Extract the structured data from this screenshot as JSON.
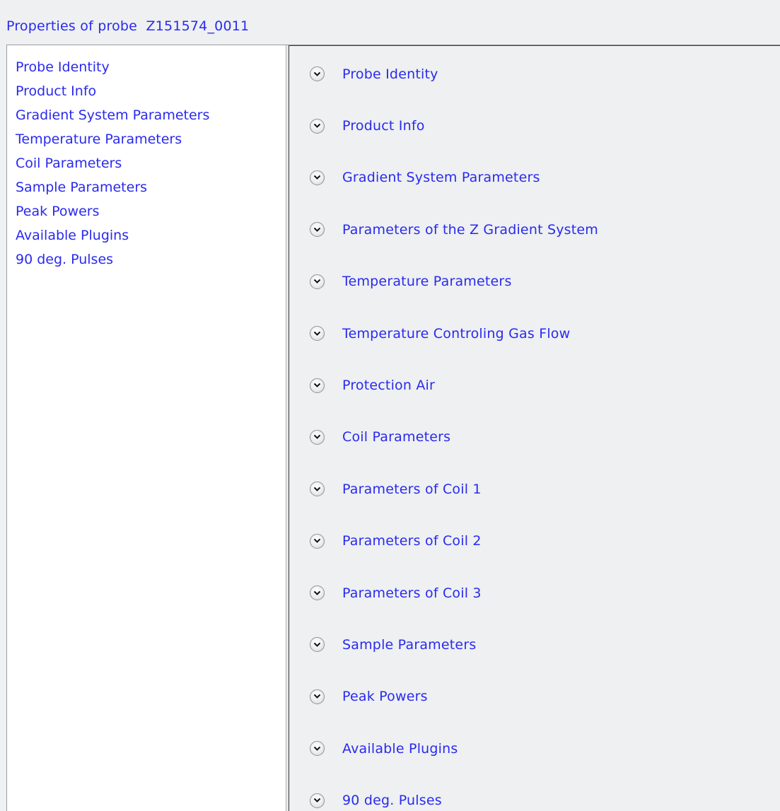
{
  "window": {
    "title": "Properties of probe  Z151574_0011"
  },
  "navigation": {
    "items": [
      {
        "label": "Probe Identity"
      },
      {
        "label": "Product Info"
      },
      {
        "label": "Gradient System Parameters"
      },
      {
        "label": "Temperature Parameters"
      },
      {
        "label": "Coil Parameters"
      },
      {
        "label": "Sample Parameters"
      },
      {
        "label": "Peak Powers"
      },
      {
        "label": "Available Plugins"
      },
      {
        "label": "90 deg. Pulses"
      }
    ]
  },
  "sections": {
    "expand_icon": "chevron-down-circle-icon",
    "items": [
      {
        "label": "Probe Identity"
      },
      {
        "label": "Product Info"
      },
      {
        "label": "Gradient System Parameters"
      },
      {
        "label": "Parameters of the Z Gradient System"
      },
      {
        "label": "Temperature Parameters"
      },
      {
        "label": "Temperature Controling Gas Flow"
      },
      {
        "label": "Protection Air"
      },
      {
        "label": "Coil Parameters"
      },
      {
        "label": "Parameters of Coil 1"
      },
      {
        "label": "Parameters of Coil 2"
      },
      {
        "label": "Parameters of Coil 3"
      },
      {
        "label": "Sample Parameters"
      },
      {
        "label": "Peak Powers"
      },
      {
        "label": "Available Plugins"
      },
      {
        "label": "90 deg. Pulses"
      }
    ]
  },
  "colors": {
    "link_text": "#2a2aee",
    "nav_background": "#ffffff",
    "content_background": "#eef0f1"
  }
}
